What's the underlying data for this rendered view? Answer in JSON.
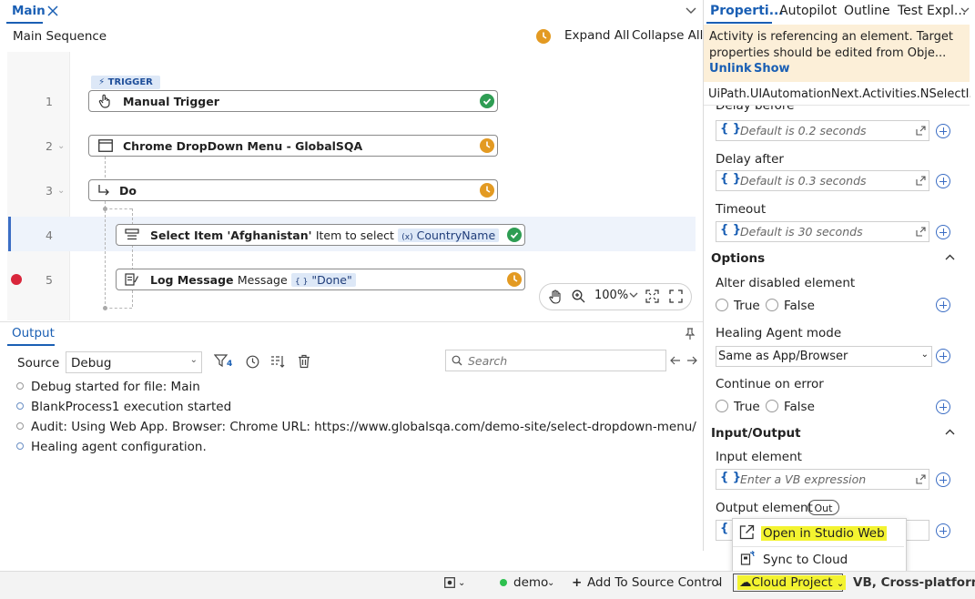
{
  "designer": {
    "tab_label": "Main",
    "sequence_title": "Main Sequence",
    "expand_all": "Expand All",
    "collapse_all": "Collapse All",
    "trigger_badge": "TRIGGER",
    "zoom": "100%",
    "activities": [
      {
        "line": "1",
        "title": "Manual Trigger",
        "status": "ok"
      },
      {
        "line": "2",
        "title": "Chrome DropDown Menu - GlobalSQA",
        "status": "warning"
      },
      {
        "line": "3",
        "title": "Do",
        "status": "warning"
      },
      {
        "line": "4",
        "title": "Select Item 'Afghanistan'",
        "param_label": "Item to select",
        "param_value": "CountryName",
        "status": "ok"
      },
      {
        "line": "5",
        "title": "Log Message",
        "param_label": "Message",
        "param_value": "\"Done\"",
        "status": "warning"
      }
    ]
  },
  "output": {
    "tab_label": "Output",
    "source_label": "Source",
    "source_value": "Debug",
    "filter_count": "4",
    "search_placeholder": "Search",
    "logs": [
      "Debug started for file: Main",
      "BlankProcess1 execution started",
      "Audit: Using Web App. Browser: Chrome URL: https://www.globalsqa.com/demo-site/select-dropdown-menu/",
      "Healing agent configuration."
    ]
  },
  "properties": {
    "tabs": [
      "Properti...",
      "Autopilot",
      "Outline",
      "Test Expl..."
    ],
    "warning_text": "Activity is referencing an element. Target properties should be edited from Obje...",
    "unlink": "Unlink",
    "show": "Show",
    "activity_type": "UiPath.UIAutomationNext.Activities.NSelectI...",
    "cut_label": "Delay before",
    "delay_before_ph": "Default is 0.2 seconds",
    "delay_after_label": "Delay after",
    "delay_after_ph": "Default is 0.3 seconds",
    "timeout_label": "Timeout",
    "timeout_ph": "Default is 30 seconds",
    "options_header": "Options",
    "alter_disabled_label": "Alter disabled element",
    "true_label": "True",
    "false_label": "False",
    "healing_label": "Healing Agent mode",
    "healing_value": "Same as App/Browser",
    "continue_label": "Continue on error",
    "io_header": "Input/Output",
    "input_element_label": "Input element",
    "input_element_ph": "Enter a VB expression",
    "output_element_label": "Output element",
    "out_badge": "Out"
  },
  "popup": {
    "open_web": "Open in Studio Web",
    "sync_cloud": "Sync to Cloud"
  },
  "statusbar": {
    "branch": "demo",
    "add_source": "Add To Source Control",
    "cloud_project": "Cloud Project",
    "lang": "VB, Cross-platform"
  }
}
